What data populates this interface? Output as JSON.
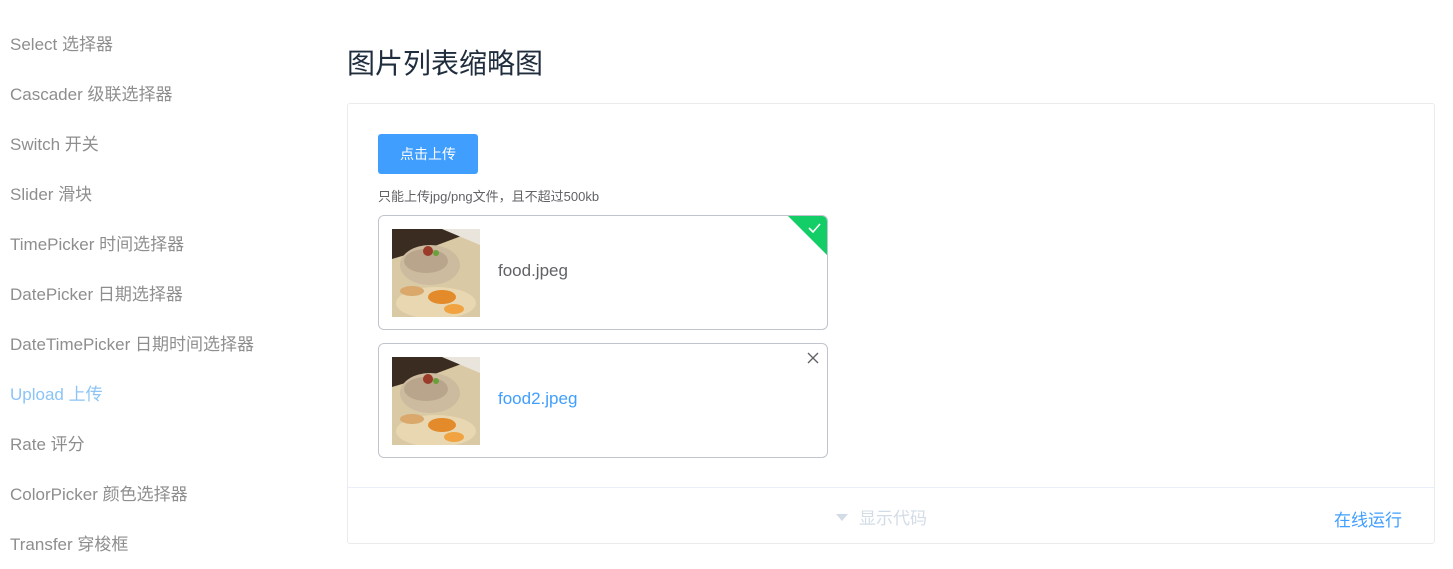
{
  "sidebar": {
    "items": [
      {
        "label": "Select 选择器",
        "active": false
      },
      {
        "label": "Cascader 级联选择器",
        "active": false
      },
      {
        "label": "Switch 开关",
        "active": false
      },
      {
        "label": "Slider 滑块",
        "active": false
      },
      {
        "label": "TimePicker 时间选择器",
        "active": false
      },
      {
        "label": "DatePicker 日期选择器",
        "active": false
      },
      {
        "label": "DateTimePicker 日期时间选择器",
        "active": false
      },
      {
        "label": "Upload 上传",
        "active": true
      },
      {
        "label": "Rate 评分",
        "active": false
      },
      {
        "label": "ColorPicker 颜色选择器",
        "active": false
      },
      {
        "label": "Transfer 穿梭框",
        "active": false
      }
    ]
  },
  "main": {
    "title": "图片列表缩略图",
    "upload_button_label": "点击上传",
    "tip": "只能上传jpg/png文件，且不超过500kb",
    "files": [
      {
        "name": "food.jpeg",
        "status": "success"
      },
      {
        "name": "food2.jpeg",
        "status": "hover"
      }
    ],
    "controls": {
      "toggle_code_label": "显示代码",
      "run_online_label": "在线运行"
    }
  },
  "colors": {
    "primary": "#409eff",
    "success": "#13ce66",
    "active_sidebar": "#8cc4f5",
    "muted_text": "#8e8e8e"
  },
  "icons": {
    "success": "check-icon",
    "remove": "close-icon",
    "toggle": "caret-down-icon"
  }
}
